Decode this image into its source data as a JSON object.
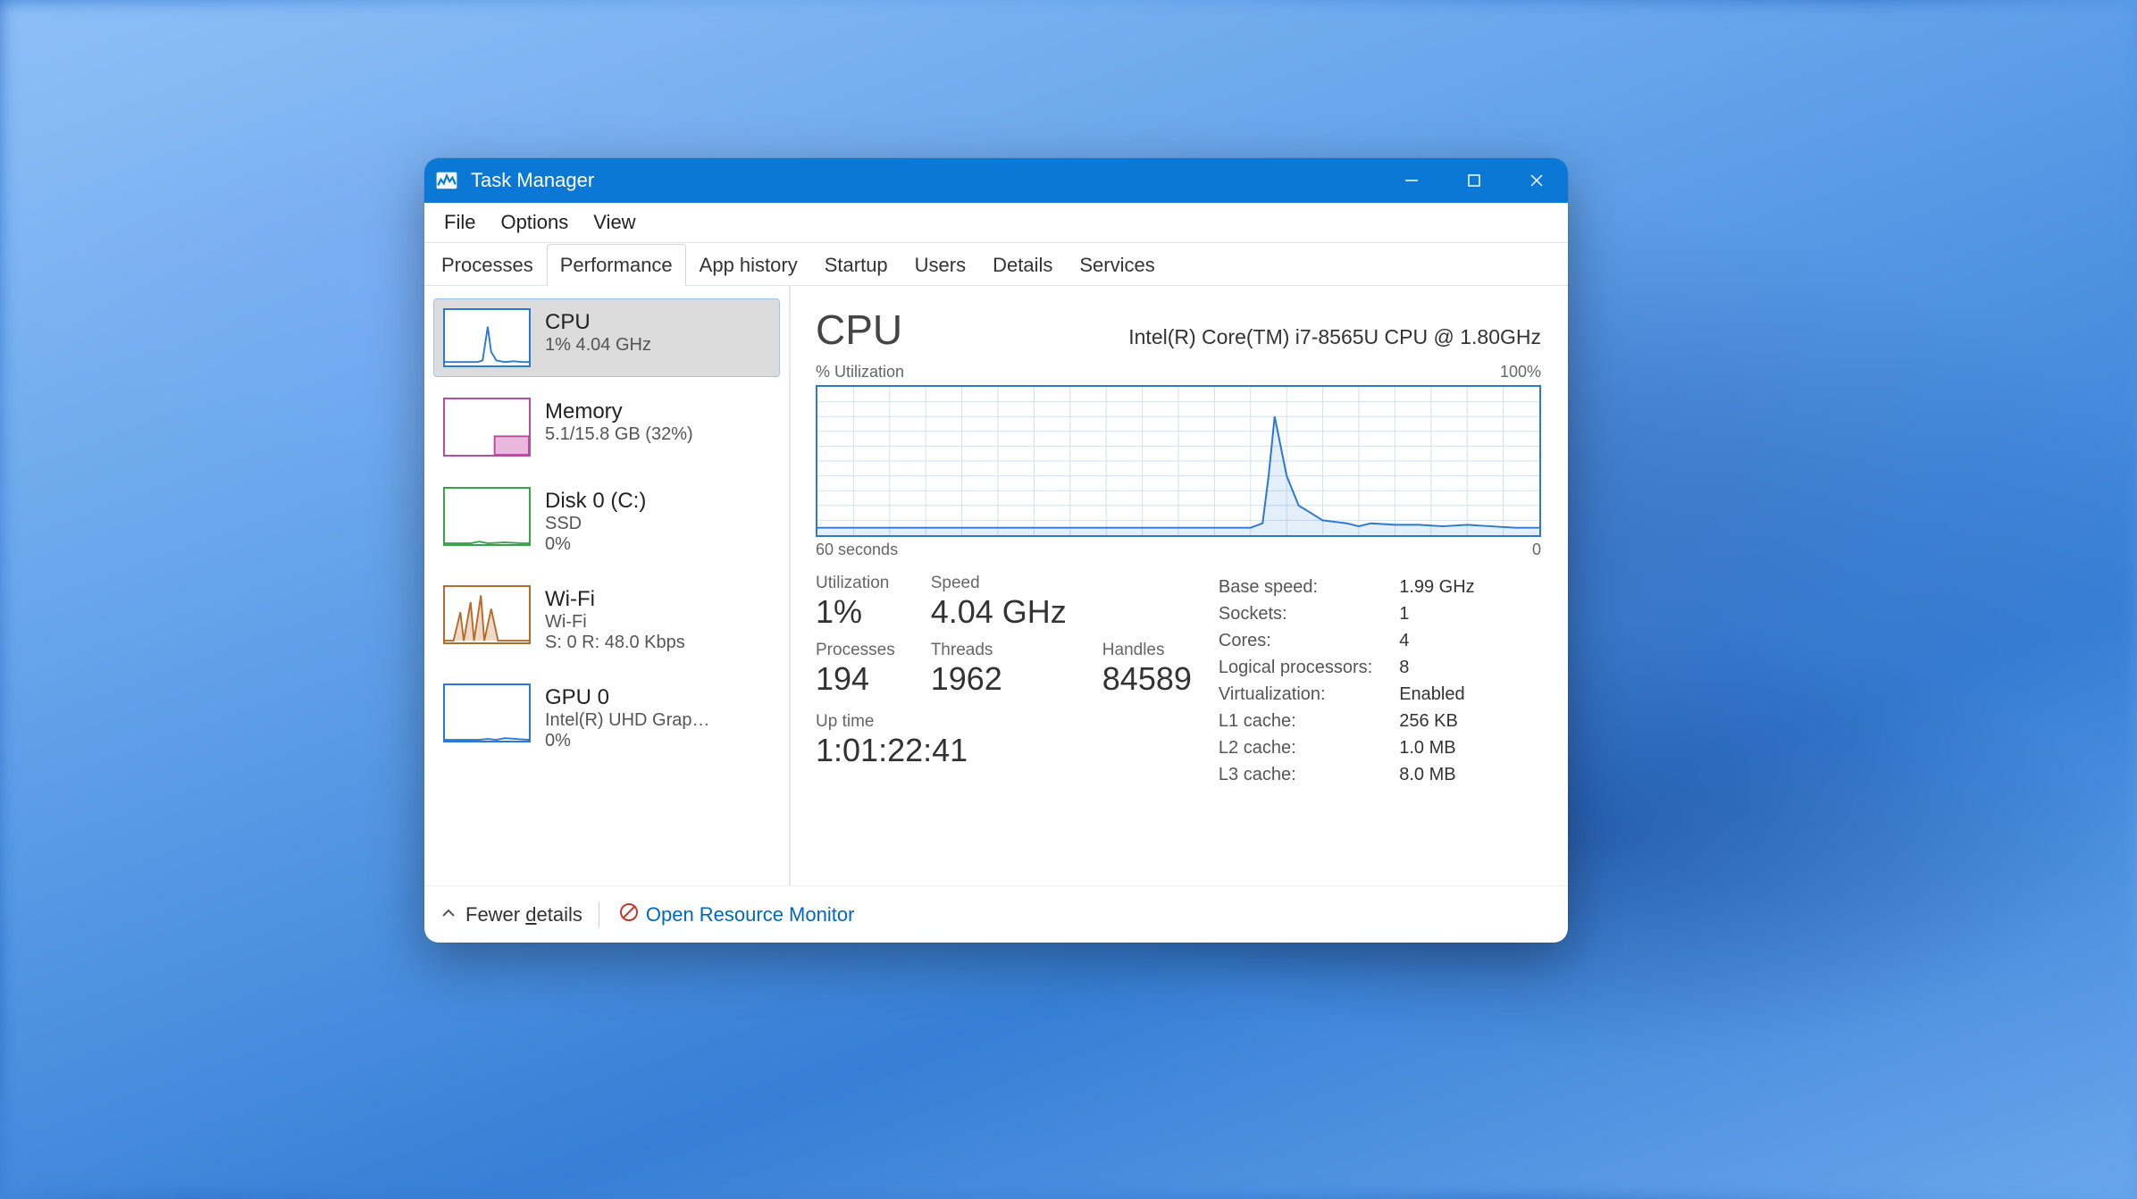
{
  "titlebar": {
    "title": "Task Manager"
  },
  "menubar": [
    "File",
    "Options",
    "View"
  ],
  "tabs": [
    "Processes",
    "Performance",
    "App history",
    "Startup",
    "Users",
    "Details",
    "Services"
  ],
  "active_tab": "Performance",
  "sidebar": [
    {
      "id": "cpu",
      "title": "CPU",
      "line1": "1%  4.04 GHz",
      "line2": "",
      "color": "#2b79d0",
      "selected": true
    },
    {
      "id": "memory",
      "title": "Memory",
      "line1": "5.1/15.8 GB (32%)",
      "line2": "",
      "color": "#b84aa0"
    },
    {
      "id": "disk0",
      "title": "Disk 0 (C:)",
      "line1": "SSD",
      "line2": "0%",
      "color": "#3aa34a"
    },
    {
      "id": "wifi",
      "title": "Wi-Fi",
      "line1": "Wi-Fi",
      "line2": "S: 0  R: 48.0 Kbps",
      "color": "#b86a2a"
    },
    {
      "id": "gpu0",
      "title": "GPU 0",
      "line1": "Intel(R) UHD Grap…",
      "line2": "0%",
      "color": "#2b79d0"
    }
  ],
  "detail": {
    "heading": "CPU",
    "model": "Intel(R) Core(TM) i7-8565U CPU @ 1.80GHz",
    "chart_top_left": "% Utilization",
    "chart_top_right": "100%",
    "chart_bottom_left": "60 seconds",
    "chart_bottom_right": "0",
    "stats_left": [
      {
        "label": "Utilization",
        "value": "1%"
      },
      {
        "label": "Speed",
        "value": "4.04 GHz"
      },
      {
        "label": "",
        "value": ""
      },
      {
        "label": "Processes",
        "value": "194"
      },
      {
        "label": "Threads",
        "value": "1962"
      },
      {
        "label": "Handles",
        "value": "84589"
      }
    ],
    "uptime": {
      "label": "Up time",
      "value": "1:01:22:41"
    },
    "stats_right": [
      {
        "label": "Base speed:",
        "value": "1.99 GHz"
      },
      {
        "label": "Sockets:",
        "value": "1"
      },
      {
        "label": "Cores:",
        "value": "4"
      },
      {
        "label": "Logical processors:",
        "value": "8"
      },
      {
        "label": "Virtualization:",
        "value": "Enabled"
      },
      {
        "label": "L1 cache:",
        "value": "256 KB"
      },
      {
        "label": "L2 cache:",
        "value": "1.0 MB"
      },
      {
        "label": "L3 cache:",
        "value": "8.0 MB"
      }
    ]
  },
  "footer": {
    "fewer_details": "Fewer details",
    "resource_monitor": "Open Resource Monitor"
  },
  "chart_data": {
    "type": "line",
    "title": "% Utilization",
    "xlabel": "seconds ago",
    "ylabel": "% Utilization",
    "ylim": [
      0,
      100
    ],
    "xlim_seconds": [
      60,
      0
    ],
    "series": [
      {
        "name": "CPU % Utilization",
        "x_seconds_ago": [
          60,
          57,
          54,
          51,
          48,
          45,
          42,
          39,
          36,
          33,
          30,
          27,
          24,
          23,
          22.5,
          22,
          21,
          20,
          19,
          18,
          17,
          16,
          15,
          14,
          12,
          10,
          8,
          6,
          4,
          2,
          0
        ],
        "values": [
          5,
          5,
          5,
          5,
          5,
          5,
          5,
          5,
          5,
          5,
          5,
          5,
          5,
          8,
          40,
          80,
          40,
          20,
          15,
          10,
          9,
          8,
          6,
          8,
          7,
          7,
          6,
          7,
          6,
          5,
          5
        ]
      }
    ]
  }
}
